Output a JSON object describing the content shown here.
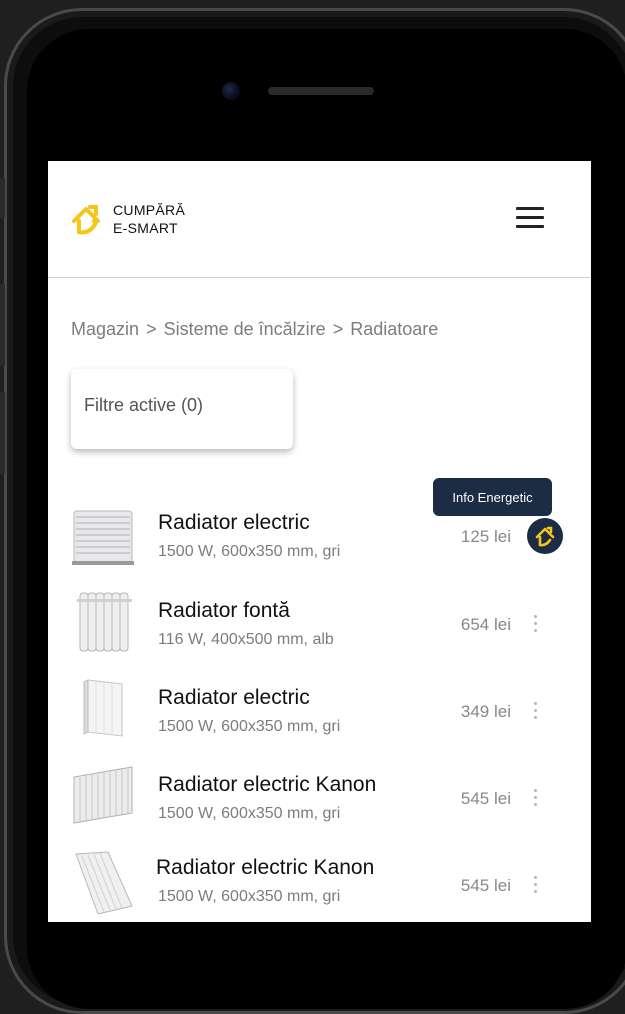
{
  "brand": {
    "line1": "CUMPĂRĂ",
    "line2": "E-SMART",
    "accent": "#f5c518"
  },
  "breadcrumb": [
    "Magazin",
    "Sisteme de încălzire",
    "Radiatoare"
  ],
  "breadcrumb_sep": ">",
  "filters": {
    "label": "Filtre active (0)"
  },
  "tooltip": "Info Energetic",
  "products": [
    {
      "name": "Radiator electric",
      "desc": "1500 W, 600x350 mm, gri",
      "price": "125 lei",
      "action_icon": "energy-house-icon"
    },
    {
      "name": "Radiator fontă",
      "desc": "116 W, 400x500 mm, alb",
      "price": "654 lei",
      "action_icon": "more-vert-icon"
    },
    {
      "name": "Radiator electric",
      "desc": "1500 W, 600x350 mm, gri",
      "price": "349  lei",
      "action_icon": "more-vert-icon"
    },
    {
      "name": "Radiator electric Kanon",
      "desc": "1500 W, 600x350 mm, gri",
      "price": "545 lei",
      "action_icon": "more-vert-icon"
    },
    {
      "name": "Radiator electric Kanon",
      "desc": "1500 W, 600x350 mm, gri",
      "price": "545 lei",
      "action_icon": "more-vert-icon"
    }
  ],
  "colors": {
    "dark_navy": "#1c2c44",
    "text_gray": "#7d7d7d"
  }
}
